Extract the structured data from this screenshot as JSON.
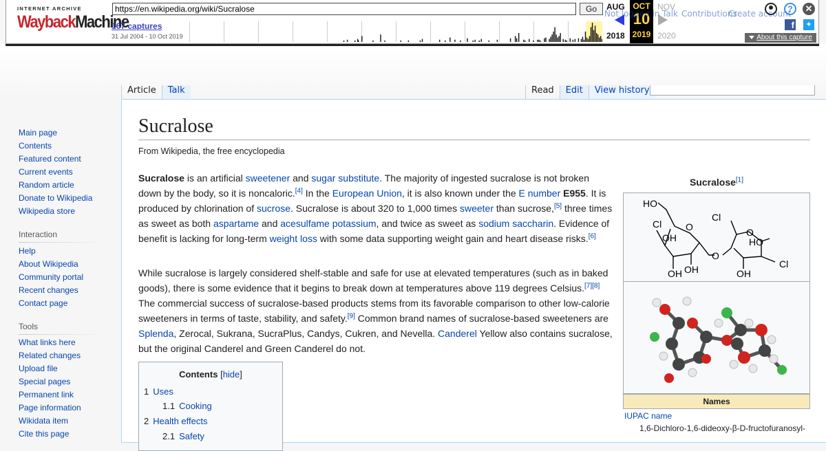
{
  "wayback": {
    "logo_line1": "INTERNET ARCHIVE",
    "logo_wayback": "Wayback",
    "logo_machine": "Machine",
    "url": "https://en.wikipedia.org/wiki/Sucralose",
    "go_label": "Go",
    "captures": "167 captures",
    "range": "31 Jul 2004 - 10 Oct 2019",
    "prev_month": "AUG",
    "prev_year": "2018",
    "current_month": "OCT",
    "current_day": "10",
    "current_year": "2019",
    "next_month": "NOV",
    "next_year": "2020",
    "about_label": "About this capture",
    "sparkline": [
      0,
      0,
      0,
      0,
      0,
      0,
      0,
      0,
      0,
      0,
      0,
      0,
      0,
      0,
      0,
      0,
      0,
      0,
      0,
      0,
      0,
      0,
      0,
      0,
      0,
      0,
      0,
      0,
      0,
      0,
      0,
      0,
      0,
      0,
      0,
      0,
      0,
      0,
      0,
      0,
      0,
      0,
      0,
      0,
      0,
      0,
      0,
      0,
      0,
      0,
      0,
      0,
      0,
      0,
      0,
      0,
      0,
      0,
      0,
      0,
      0,
      0,
      0,
      0,
      0,
      0,
      0,
      0,
      0,
      0,
      0,
      0,
      0,
      0,
      0,
      0,
      0,
      0,
      0,
      0,
      0,
      0,
      0,
      0,
      0,
      0,
      0,
      0,
      0,
      0,
      0,
      0,
      0,
      0,
      0,
      0,
      0,
      0,
      0,
      0,
      0,
      0,
      0,
      0,
      0,
      0,
      0,
      0,
      0,
      0,
      0,
      0,
      0,
      0,
      0,
      0,
      0,
      0,
      0,
      0,
      0,
      0,
      0,
      0,
      0,
      0,
      0,
      0,
      0,
      0,
      0,
      0,
      0,
      0,
      0,
      0,
      0,
      0,
      0,
      0,
      0,
      0,
      0,
      0,
      0,
      0,
      0,
      0,
      0,
      0,
      0,
      0,
      0,
      0,
      0,
      0,
      0,
      0,
      0,
      0,
      0,
      0,
      0,
      0,
      0,
      0,
      0,
      0,
      0,
      0,
      0,
      0,
      0,
      0,
      0,
      0,
      0,
      0,
      0,
      0,
      0,
      0,
      0,
      0,
      0,
      0,
      0,
      0,
      0,
      0,
      0,
      0,
      0,
      0,
      0,
      0,
      0,
      0,
      0,
      0,
      0,
      0,
      0,
      0,
      0,
      0,
      0,
      0,
      0,
      0,
      0,
      0,
      0,
      0,
      0,
      0,
      0,
      0,
      0,
      0,
      0,
      0,
      2,
      0,
      0,
      0,
      0,
      3,
      0,
      0,
      0,
      0,
      0,
      0,
      0,
      0,
      0,
      0,
      2,
      0,
      0,
      0,
      4,
      2,
      0,
      0,
      0,
      0,
      8,
      0,
      0,
      0,
      0,
      0,
      0,
      0,
      0,
      0,
      0,
      0,
      0,
      0,
      0,
      0,
      2,
      0,
      0,
      0,
      0,
      0,
      0,
      0,
      0,
      0,
      0,
      10,
      0,
      0,
      0,
      0,
      0,
      2,
      0,
      0,
      0,
      0,
      0,
      0,
      0,
      0,
      0,
      0,
      0,
      0,
      0,
      0,
      0,
      0,
      0,
      0,
      0,
      0,
      0,
      0,
      2,
      0,
      0,
      0,
      0,
      0,
      0,
      0,
      0,
      0,
      0,
      2,
      0,
      0,
      0,
      0,
      0,
      0,
      0,
      0,
      0,
      0,
      0,
      0,
      0,
      0,
      0,
      0,
      2,
      0,
      0,
      4,
      0,
      0,
      0,
      0,
      0,
      0,
      0,
      0,
      0,
      0,
      0,
      0,
      0,
      0,
      0,
      0,
      0,
      0,
      0,
      0,
      0,
      0,
      0,
      0,
      3,
      0,
      0,
      0,
      0,
      0,
      0,
      0,
      2,
      0,
      0,
      0,
      0,
      0,
      0,
      6,
      0,
      0,
      0,
      0,
      0,
      0,
      3,
      0,
      0,
      0,
      0,
      0,
      0,
      0,
      2,
      0,
      0,
      0,
      0,
      0,
      0,
      0,
      0,
      0,
      5,
      0,
      0,
      0,
      0,
      0,
      0,
      0,
      2,
      0,
      0,
      3,
      0,
      0,
      0,
      0,
      0,
      2,
      0,
      0,
      4,
      0,
      0,
      0,
      0,
      0,
      0,
      0,
      0,
      0,
      0,
      2,
      0,
      0,
      0,
      0,
      0,
      0,
      0,
      0,
      0,
      0,
      0,
      3,
      0,
      0,
      0,
      0,
      0,
      0,
      0,
      0,
      0,
      0,
      0,
      0,
      0,
      0,
      0,
      0,
      0,
      0,
      5,
      0,
      0,
      0,
      0,
      0,
      0,
      8,
      0,
      5,
      0,
      0,
      12,
      0,
      0,
      0,
      0,
      0,
      0,
      3,
      0,
      2,
      0,
      0,
      0,
      0,
      0,
      4,
      0,
      0,
      0,
      0,
      0,
      2,
      0,
      0,
      0,
      0,
      0,
      3,
      0,
      3,
      0,
      2,
      0,
      0,
      0,
      0,
      0,
      5,
      0,
      6,
      0,
      0,
      0,
      0,
      4,
      0,
      7,
      0,
      10,
      0,
      14,
      0,
      20,
      0,
      10,
      0,
      6,
      0,
      8,
      0,
      12,
      0,
      0,
      0,
      4,
      0,
      0,
      3,
      0,
      2,
      0,
      0,
      0,
      0,
      5,
      0,
      0,
      0,
      3,
      0,
      0,
      4,
      0,
      0,
      0,
      0,
      5,
      0,
      0,
      0,
      4,
      0,
      7,
      0,
      3,
      0,
      14,
      0,
      6,
      0,
      4,
      0,
      8,
      0,
      20,
      0,
      26,
      0,
      16,
      0,
      22,
      0,
      12,
      0,
      10,
      0,
      6,
      0,
      8,
      0,
      4
    ]
  },
  "header": {
    "links": [
      "Not logged in",
      "Talk",
      "Contributions",
      "Create account"
    ],
    "tabs_left": [
      "Article",
      "Talk"
    ],
    "tabs_right": [
      "Read",
      "Edit",
      "View history"
    ]
  },
  "sidebar": {
    "nav": [
      "Main page",
      "Contents",
      "Featured content",
      "Current events",
      "Random article",
      "Donate to Wikipedia",
      "Wikipedia store"
    ],
    "interaction_heading": "Interaction",
    "interaction": [
      "Help",
      "About Wikipedia",
      "Community portal",
      "Recent changes",
      "Contact page"
    ],
    "tools_heading": "Tools",
    "tools": [
      "What links here",
      "Related changes",
      "Upload file",
      "Special pages",
      "Permanent link",
      "Page information",
      "Wikidata item",
      "Cite this page"
    ]
  },
  "article": {
    "title": "Sucralose",
    "subtitle": "From Wikipedia, the free encyclopedia",
    "para1": {
      "t0": "Sucralose",
      "t1": " is an artificial ",
      "l1": "sweetener",
      "t2": " and ",
      "l2": "sugar substitute",
      "t3": ". The majority of ingested sucralose is not broken down by the body, so it is noncaloric.",
      "r1": "[4]",
      "t4": " In the ",
      "l3": "European Union",
      "t5": ", it is also known under the ",
      "l4": "E number",
      "t6": " ",
      "b1": "E955",
      "t7": ". It is produced by chlorination of ",
      "l5": "sucrose",
      "t8": ". Sucralose is about 320 to 1,000 times ",
      "l6": "sweeter",
      "t9": " than sucrose,",
      "r2": "[5]",
      "t10": " three times as sweet as both ",
      "l7": "aspartame",
      "t11": " and ",
      "l8": "acesulfame potassium",
      "t12": ", and twice as sweet as ",
      "l9": "sodium saccharin",
      "t13": ". Evidence of benefit is lacking for long-term ",
      "l10": "weight loss",
      "t14": " with some data supporting weight gain and heart disease risks.",
      "r3": "[6]"
    },
    "para2": {
      "t1": "While sucralose is largely considered shelf-stable and safe for use at elevated temperatures (such as in baked goods), there is some evidence that it begins to break down at temperatures above 119 degrees Celsius.",
      "r1": "[7]",
      "r2": "[8]",
      "t2": " The commercial success of sucralose-based products stems from its favorable comparison to other low-calorie sweeteners in terms of taste, stability, and safety.",
      "r3": "[9]",
      "t3": " Common brand names of sucralose-based sweeteners are ",
      "l1": "Splenda",
      "t4": ", Zerocal, Sukrana, SucraPlus, Candys, Cukren, and Nevella. ",
      "l2": "Canderel",
      "t5": " Yellow also contains sucralose, but the original Canderel and Green Canderel do not."
    },
    "toc": {
      "title": "Contents",
      "hide_open": "[",
      "hide": "hide",
      "hide_close": "]",
      "items": [
        {
          "num": "1",
          "label": "Uses"
        },
        {
          "num": "1.1",
          "label": "Cooking"
        },
        {
          "num": "2",
          "label": "Health effects"
        },
        {
          "num": "2.1",
          "label": "Safety"
        }
      ]
    },
    "infobox": {
      "title": "Sucralose",
      "ref": "[1]",
      "names_header": "Names",
      "iupac_label": "IUPAC name",
      "iupac_value": "1,6-Dichloro-1,6-dideoxy-β-D-fructofuranosyl-",
      "struct_labels": [
        "HO",
        "Cl",
        "OH",
        "OH",
        "O",
        "O",
        "OH",
        "Cl",
        "O",
        "HO",
        "Cl",
        "OH"
      ]
    }
  }
}
